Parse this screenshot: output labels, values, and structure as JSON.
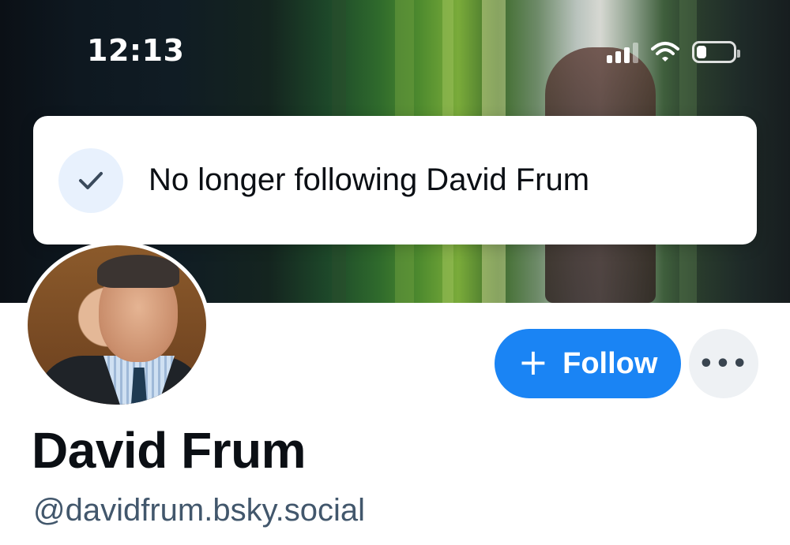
{
  "status_bar": {
    "time": "12:13",
    "icons": [
      "signal-icon",
      "wifi-icon",
      "battery-icon"
    ]
  },
  "toast": {
    "icon": "checkmark-icon",
    "message": "No longer following David Frum"
  },
  "profile": {
    "display_name": "David Frum",
    "handle": "@davidfrum.bsky.social",
    "follow_button": {
      "icon": "plus-icon",
      "label": "Follow"
    },
    "more_button": {
      "icon": "more-options-icon",
      "glyph": "•••"
    }
  },
  "colors": {
    "accent": "#1a84f4",
    "handle_text": "#42576c",
    "toast_icon_bg": "#e8f1fd"
  }
}
